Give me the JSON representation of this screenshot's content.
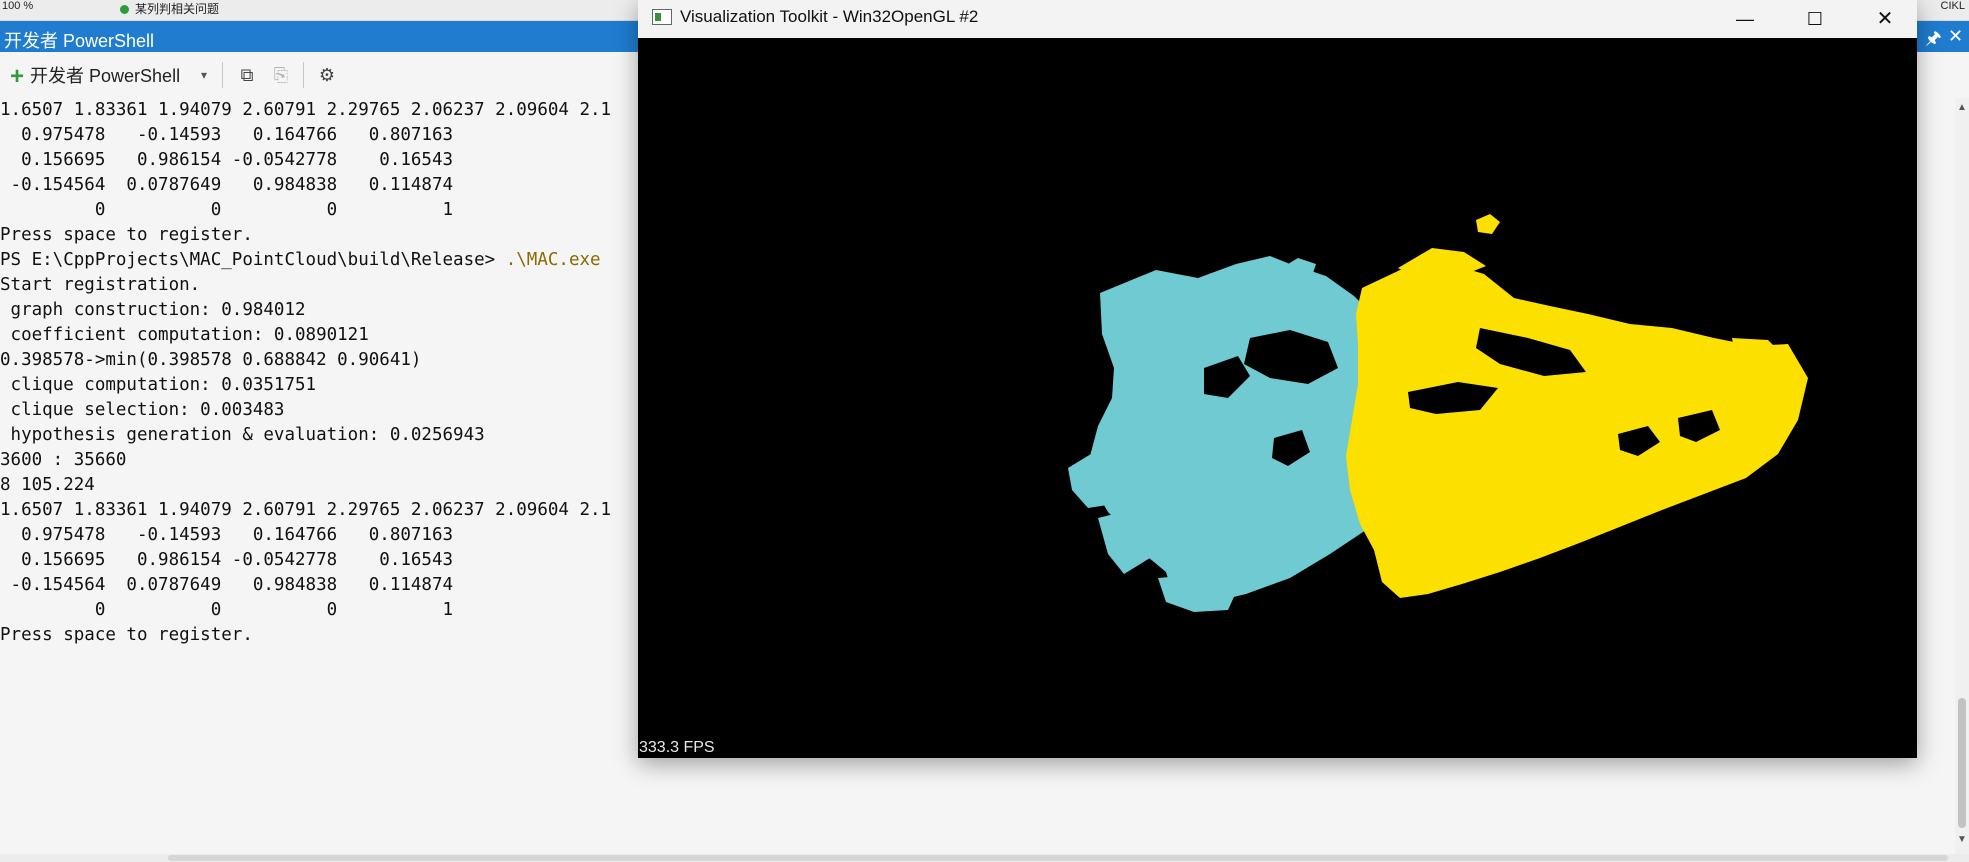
{
  "background_tabs": {
    "zoom_text": "100 %",
    "tab_label": "某列判相关问题",
    "right_label": "CIKL"
  },
  "powershell": {
    "title": "开发者 PowerShell",
    "toolbar": {
      "new_terminal_label": "开发者 PowerShell"
    },
    "console_lines": [
      {
        "text": "1.6507 1.83361 1.94079 2.60791 2.29765 2.06237 2.09604 2.1"
      },
      {
        "text": "  0.975478   -0.14593   0.164766   0.807163"
      },
      {
        "text": "  0.156695   0.986154 -0.0542778    0.16543"
      },
      {
        "text": " -0.154564  0.0787649   0.984838   0.114874"
      },
      {
        "text": "         0          0          0          1"
      },
      {
        "text": "Press space to register."
      },
      {
        "prompt": "PS E:\\CppProjects\\MAC_PointCloud\\build\\Release> ",
        "cmd": ".\\MAC.exe"
      },
      {
        "text": "Start registration."
      },
      {
        "text": " graph construction: 0.984012"
      },
      {
        "text": " coefficient computation: 0.0890121"
      },
      {
        "text": "0.398578->min(0.398578 0.688842 0.90641)"
      },
      {
        "text": " clique computation: 0.0351751"
      },
      {
        "text": " clique selection: 0.003483"
      },
      {
        "text": " hypothesis generation & evaluation: 0.0256943"
      },
      {
        "text": "3600 : 35660"
      },
      {
        "text": "8 105.224"
      },
      {
        "text": "1.6507 1.83361 1.94079 2.60791 2.29765 2.06237 2.09604 2.1"
      },
      {
        "text": "  0.975478   -0.14593   0.164766   0.807163"
      },
      {
        "text": "  0.156695   0.986154 -0.0542778    0.16543"
      },
      {
        "text": " -0.154564  0.0787649   0.984838   0.114874"
      },
      {
        "text": "         0          0          0          1"
      },
      {
        "text": "Press space to register."
      }
    ]
  },
  "vtk": {
    "title": "Visualization Toolkit - Win32OpenGL #2",
    "fps": "333.3 FPS",
    "colors": {
      "background": "#000000",
      "source_cloud": "#6fcad2",
      "target_cloud": "#fbe000"
    }
  }
}
